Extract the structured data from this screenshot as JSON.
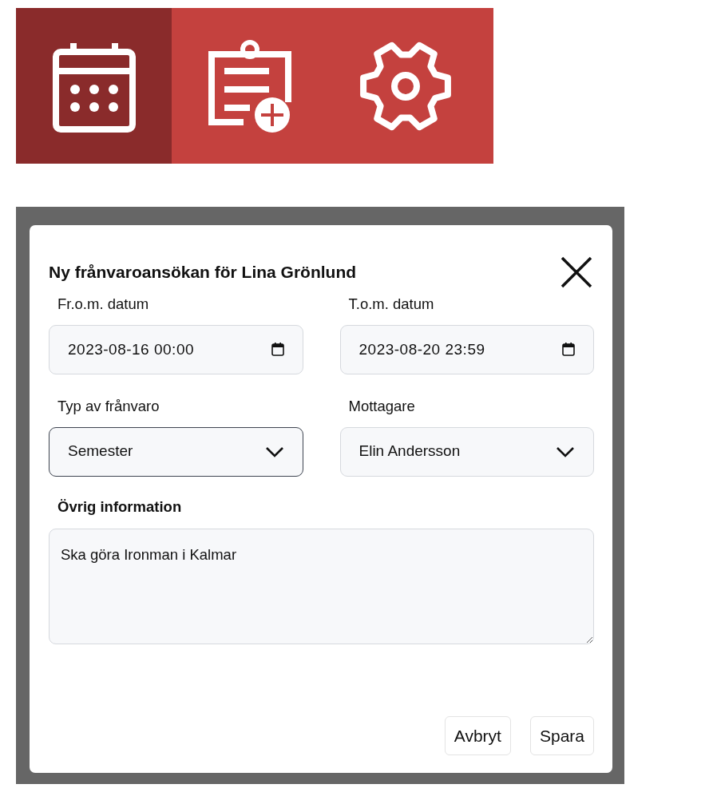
{
  "nav": {
    "items": [
      {
        "kind": "calendar",
        "selected": true
      },
      {
        "kind": "clipboard-add",
        "selected": false
      },
      {
        "kind": "settings",
        "selected": false
      }
    ]
  },
  "dialog": {
    "title": "Ny frånvaroansökan för Lina Grönlund",
    "fields": [
      {
        "kind": "date",
        "label": "Fr.o.m. datum",
        "value": "2023-08-16 00:00",
        "focused": false
      },
      {
        "kind": "date",
        "label": "T.o.m. datum",
        "value": "2023-08-20 23:59",
        "focused": false
      },
      {
        "kind": "select",
        "label": "Typ av frånvaro",
        "value": "Semester",
        "focused": true
      },
      {
        "kind": "select",
        "label": "Mottagare",
        "value": "Elin Andersson",
        "focused": false
      }
    ],
    "notes": {
      "label": "Övrig information",
      "value": "Ska göra Ironman i Kalmar"
    },
    "buttons": [
      "Avbryt",
      "Spara"
    ]
  }
}
